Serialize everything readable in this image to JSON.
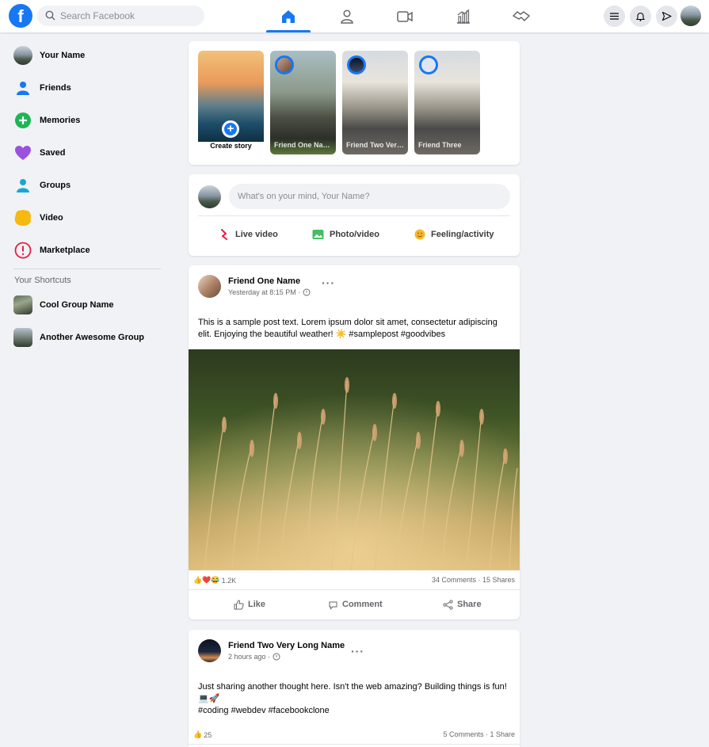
{
  "nav": {
    "logo": "f",
    "search_placeholder": "Search Facebook",
    "tabs": [
      {
        "name": "home-icon"
      },
      {
        "name": "person-icon"
      },
      {
        "name": "video-icon"
      },
      {
        "name": "chart-icon"
      },
      {
        "name": "handshake-icon"
      }
    ],
    "accent": "#1877f2"
  },
  "sidebar": {
    "items": [
      {
        "label": "Your Name",
        "icon": "avatar"
      },
      {
        "label": "Friends",
        "icon": "friends-icon"
      },
      {
        "label": "Memories",
        "icon": "plus-icon"
      },
      {
        "label": "Saved",
        "icon": "heart-icon"
      },
      {
        "label": "Groups",
        "icon": "groups-icon"
      },
      {
        "label": "Video",
        "icon": "video-blob-icon"
      },
      {
        "label": "Marketplace",
        "icon": "alert-icon"
      }
    ],
    "shortcuts_title": "Your Shortcuts",
    "shortcuts": [
      {
        "label": "Cool Group Name"
      },
      {
        "label": "Another Awesome Group"
      }
    ]
  },
  "stories": {
    "create_label": "Create story",
    "plus": "+",
    "items": [
      {
        "name": "Friend One Name"
      },
      {
        "name": "Friend Two Very Long Name"
      },
      {
        "name": "Friend Three"
      }
    ]
  },
  "composer": {
    "placeholder": "What's on your mind, Your Name?",
    "actions": [
      {
        "label": "Live video",
        "icon": "live-icon"
      },
      {
        "label": "Photo/video",
        "icon": "photo-icon"
      },
      {
        "label": "Feeling/activity",
        "icon": "smiley-icon"
      }
    ]
  },
  "posts": [
    {
      "author": "Friend One Name",
      "time": "Yesterday at 8:15 PM ·",
      "more": "···",
      "text": "This is a sample post text. Lorem ipsum dolor sit amet, consectetur adipiscing elit. Enjoying the beautiful weather! ☀️ #samplepost #goodvibes",
      "reaction_emojis": "👍❤️😂",
      "reaction_count": "1.2K",
      "counts": "34 Comments · 15 Shares",
      "actions": [
        "Like",
        "Comment",
        "Share"
      ]
    },
    {
      "author": "Friend Two Very Long Name",
      "time": "2 hours ago ·",
      "more": "···",
      "text_line1": "Just sharing another thought here. Isn't the web amazing? Building things is fun!",
      "text_line2": "💻🚀",
      "text_line3": "#coding #webdev #facebookclone",
      "reaction_emojis": "👍",
      "reaction_count": "25",
      "counts": "5 Comments · 1 Share"
    }
  ]
}
